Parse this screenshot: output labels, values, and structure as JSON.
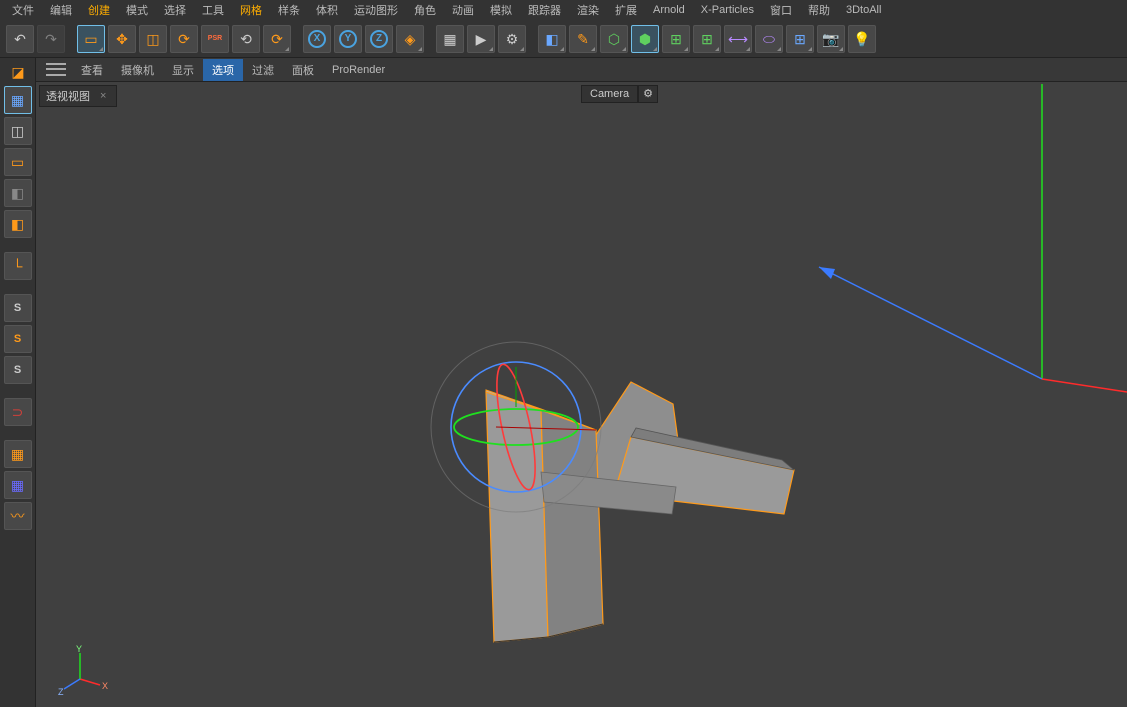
{
  "menu": {
    "items": [
      "文件",
      "编辑",
      "创建",
      "模式",
      "选择",
      "工具",
      "网格",
      "样条",
      "体积",
      "运动图形",
      "角色",
      "动画",
      "模拟",
      "跟踪器",
      "渲染",
      "扩展",
      "Arnold",
      "X-Particles",
      "窗口",
      "帮助",
      "3DtoAll"
    ],
    "hot_indices": [
      2,
      6
    ]
  },
  "toolbar": {
    "undo": "↶",
    "redo": "↷",
    "live_select": "▭",
    "move": "✥",
    "scale": "◫",
    "rotate": "⟳",
    "psr_label": "PSR",
    "last_tool": "⟳",
    "axis_x": "X",
    "axis_y": "Y",
    "axis_z": "Z",
    "coord": "◈",
    "render": "▦",
    "render_reg": "▶",
    "render_set": "⚙",
    "prim": "◧",
    "spline": "✎",
    "generator": "⬡",
    "deformer": "⬢",
    "env": "⊞",
    "array": "⊞",
    "camera": "⟷",
    "light": "⬭",
    "floor": "⊞",
    "cam2": "📷",
    "bulb": "💡"
  },
  "viewport_header": {
    "items": [
      "查看",
      "摄像机",
      "显示",
      "选项",
      "过滤",
      "面板",
      "ProRender"
    ],
    "hot_index": 3
  },
  "viewport": {
    "label": "透视视图",
    "close": "×",
    "camera_label": "Camera",
    "camera_cfg": "⚙"
  },
  "leftrail": {
    "make_editable": "◪",
    "model": "▦",
    "tex": "◫",
    "workplane": "▭",
    "cube": "◧",
    "cube_or": "◧",
    "axis_l": "└",
    "s1": "S",
    "s2": "S",
    "s3": "S",
    "magnet": "⊃",
    "grid1": "▦",
    "grid2": "▦",
    "cloth": "〰"
  },
  "axis_labels": {
    "x": "X",
    "y": "Y",
    "z": "Z"
  }
}
